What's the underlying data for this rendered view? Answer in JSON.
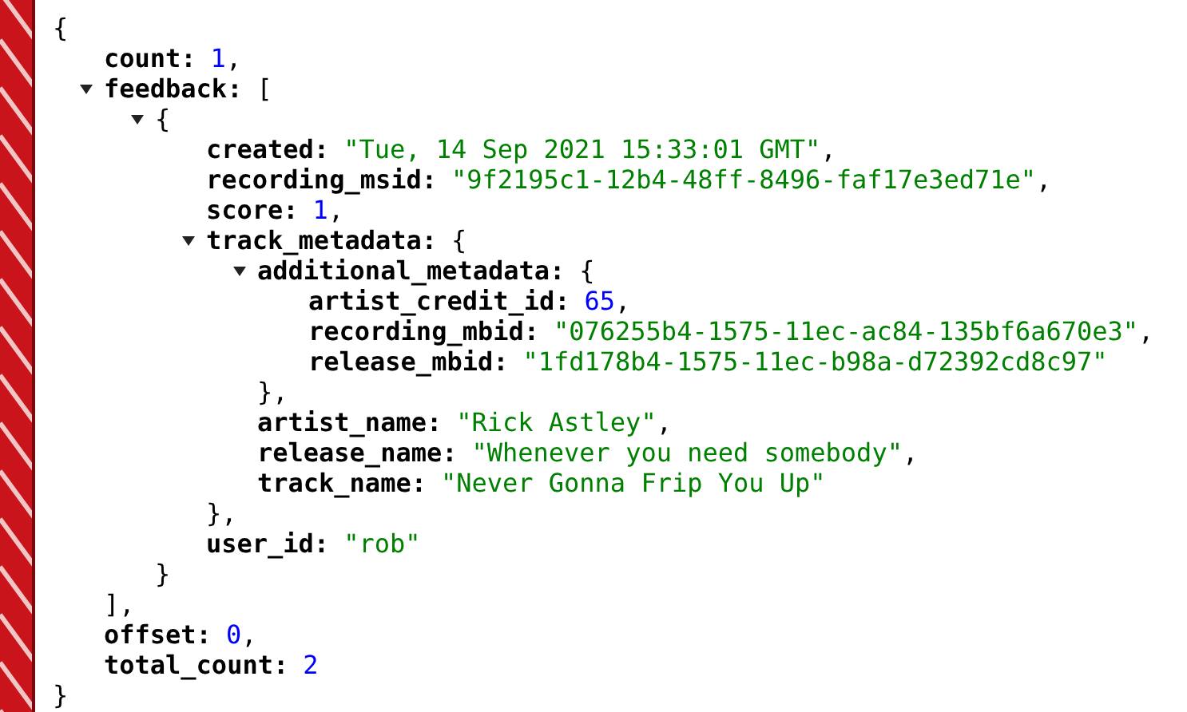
{
  "root": {
    "kind": "object",
    "open": "{",
    "close": "}",
    "children": [
      {
        "kind": "number",
        "key": "count:",
        "value": "1",
        "trail": ","
      },
      {
        "kind": "array",
        "key": "feedback:",
        "open": "[",
        "close": "],",
        "expanded": true,
        "children": [
          {
            "kind": "object",
            "open": "{",
            "close": "}",
            "expanded": true,
            "children": [
              {
                "kind": "string",
                "key": "created:",
                "value": "\"Tue, 14 Sep 2021 15:33:01 GMT\"",
                "trail": ","
              },
              {
                "kind": "string",
                "key": "recording_msid:",
                "value": "\"9f2195c1-12b4-48ff-8496-faf17e3ed71e\"",
                "trail": ","
              },
              {
                "kind": "number",
                "key": "score:",
                "value": "1",
                "trail": ","
              },
              {
                "kind": "object",
                "key": "track_metadata:",
                "open": "{",
                "close": "},",
                "expanded": true,
                "children": [
                  {
                    "kind": "object",
                    "key": "additional_metadata:",
                    "open": "{",
                    "close": "},",
                    "expanded": true,
                    "children": [
                      {
                        "kind": "number",
                        "key": "artist_credit_id:",
                        "value": "65",
                        "trail": ","
                      },
                      {
                        "kind": "string",
                        "key": "recording_mbid:",
                        "value": "\"076255b4-1575-11ec-ac84-135bf6a670e3\"",
                        "trail": ","
                      },
                      {
                        "kind": "string",
                        "key": "release_mbid:",
                        "value": "\"1fd178b4-1575-11ec-b98a-d72392cd8c97\""
                      }
                    ]
                  },
                  {
                    "kind": "string",
                    "key": "artist_name:",
                    "value": "\"Rick Astley\"",
                    "trail": ","
                  },
                  {
                    "kind": "string",
                    "key": "release_name:",
                    "value": "\"Whenever you need somebody\"",
                    "trail": ","
                  },
                  {
                    "kind": "string",
                    "key": "track_name:",
                    "value": "\"Never Gonna Frip You Up\""
                  }
                ]
              },
              {
                "kind": "string",
                "key": "user_id:",
                "value": "\"rob\""
              }
            ]
          }
        ]
      },
      {
        "kind": "number",
        "key": "offset:",
        "value": "0",
        "trail": ","
      },
      {
        "kind": "number",
        "key": "total_count:",
        "value": "2"
      }
    ]
  }
}
